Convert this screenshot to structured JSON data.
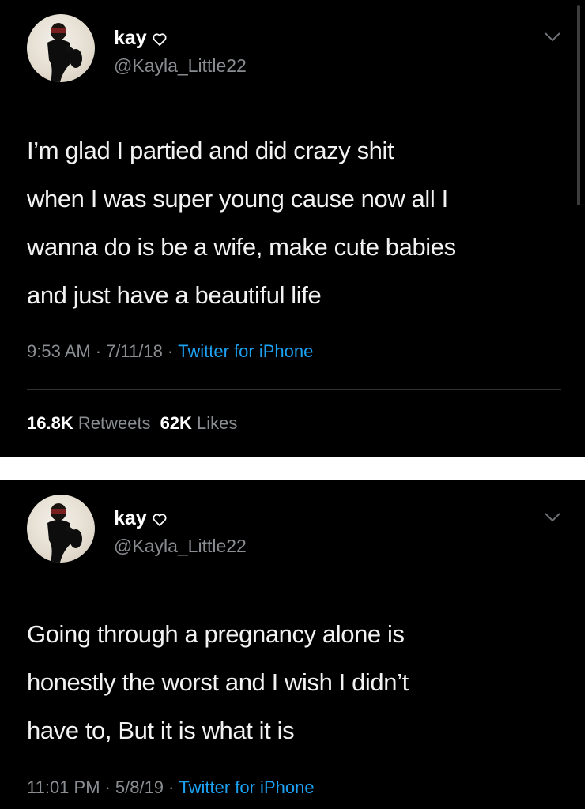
{
  "tweets": [
    {
      "display_name": "kay",
      "handle": "@Kayla_Little22",
      "text": "I’m glad I partied and did crazy shit\nwhen I was super young cause now all I\nwanna do is be a wife, make cute babies\nand just have a beautiful life",
      "time": "9:53 AM",
      "date": "7/11/18",
      "separator": "·",
      "source": "Twitter for iPhone",
      "retweets_count": "16.8K",
      "retweets_label": "Retweets",
      "likes_count": "62K",
      "likes_label": "Likes"
    },
    {
      "display_name": "kay",
      "handle": "@Kayla_Little22",
      "text": "Going through a pregnancy alone is\nhonestly the worst and I wish I didn’t\nhave to, But it is what it is",
      "time": "11:01 PM",
      "date": "5/8/19",
      "separator": "·",
      "source": "Twitter for iPhone"
    }
  ],
  "colors": {
    "background": "#000000",
    "text": "#f2f2f2",
    "secondary_text": "#8a8d91",
    "link": "#1da1f2",
    "divider": "#2f3336"
  },
  "icons": {
    "heart": "heart-outline-icon",
    "menu": "chevron-down-icon",
    "avatar": "profile-photo"
  }
}
